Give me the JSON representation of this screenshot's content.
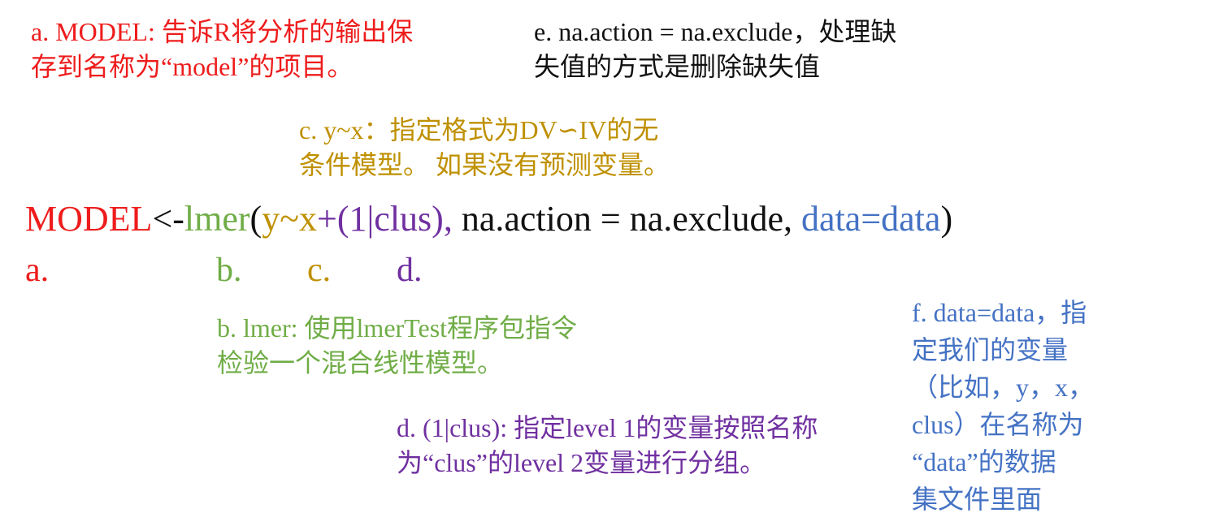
{
  "colors": {
    "red": "#ee1c1c",
    "green": "#70ad47",
    "gold": "#bf9000",
    "purple": "#7030a0",
    "blue": "#4472c4",
    "black": "#111111"
  },
  "notes": {
    "a": [
      "a. MODEL: 告诉R将分析的输出保",
      "存到名称为“model”的项目。"
    ],
    "e": [
      "e. na.action = na.exclude，处理缺",
      "失值的方式是删除缺失值"
    ],
    "c": [
      "c. y~x：指定格式为DV∽IV的无",
      "条件模型。 如果没有预测变量。"
    ],
    "b": [
      "b. lmer: 使用lmerTest程序包指令",
      "检验一个混合线性模型。"
    ],
    "d": [
      "d. (1|clus): 指定level 1的变量按照名称",
      "为“clus”的level 2变量进行分组。"
    ],
    "f": [
      "f. data=data，指",
      "定我们的变量",
      "（比如，y，x，",
      "clus）在名称为",
      "“data”的数据",
      "集文件里面"
    ]
  },
  "formula": {
    "model": "MODEL",
    "assign": "<-",
    "lmer": "lmer",
    "open_paren": "(",
    "yx": "y~x",
    "plus": "+",
    "clus_term": "(1|clus),",
    "na_action": " na.action = na.exclude, ",
    "data_arg": "data=data",
    "close_paren": ")"
  },
  "markers": {
    "a": "a.",
    "b": "b.",
    "c": "c.",
    "d": "d."
  }
}
